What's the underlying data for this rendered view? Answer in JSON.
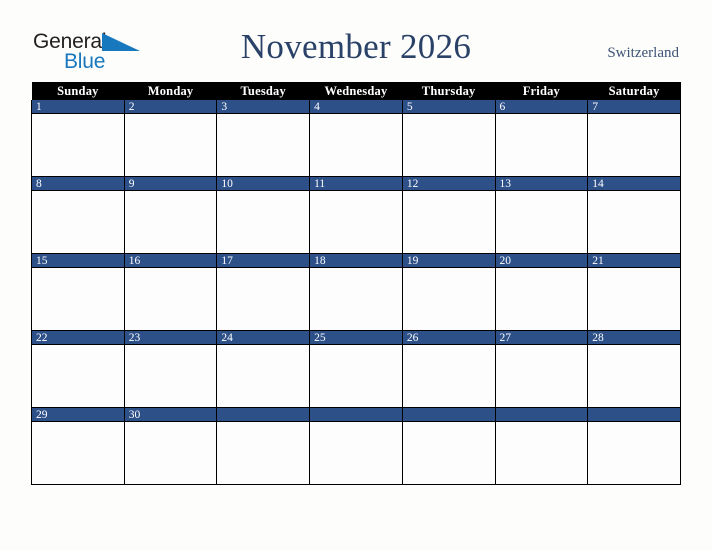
{
  "logo": {
    "word_top": "General",
    "word_bottom": "Blue",
    "triangle_icon": "blue-triangle-icon",
    "color_dark": "#231f20",
    "color_blue": "#1878be"
  },
  "header": {
    "month_title": "November 2026",
    "country": "Switzerland",
    "title_color": "#2b4268",
    "country_color": "#3d5375"
  },
  "calendar": {
    "weekdays": [
      "Sunday",
      "Monday",
      "Tuesday",
      "Wednesday",
      "Thursday",
      "Friday",
      "Saturday"
    ],
    "header_bg": "#000000",
    "header_text_color": "#ffffff",
    "day_band_bg": "#2d5089",
    "day_number_color": "#ffffff",
    "cell_bg": "#fdfdfd",
    "border_color": "#000000",
    "weeks": [
      [
        "1",
        "2",
        "3",
        "4",
        "5",
        "6",
        "7"
      ],
      [
        "8",
        "9",
        "10",
        "11",
        "12",
        "13",
        "14"
      ],
      [
        "15",
        "16",
        "17",
        "18",
        "19",
        "20",
        "21"
      ],
      [
        "22",
        "23",
        "24",
        "25",
        "26",
        "27",
        "28"
      ],
      [
        "29",
        "30",
        "",
        "",
        "",
        "",
        ""
      ]
    ]
  },
  "page": {
    "background": "#fdfdfb"
  }
}
